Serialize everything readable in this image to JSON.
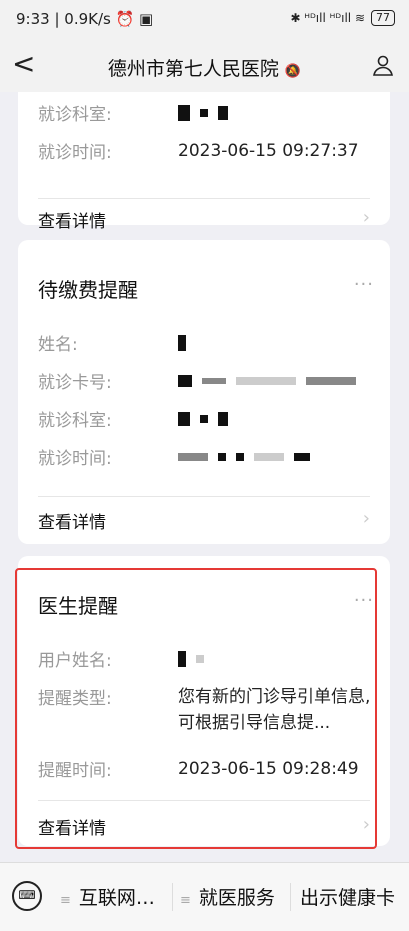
{
  "status_bar": {
    "time": "9:33",
    "speed": "0.9K/s",
    "signal": "✱ ᴴᴰıll ᴴᴰıll ≋",
    "battery": "77"
  },
  "nav": {
    "back": "<",
    "title": "德州市第七人民医院",
    "mute_icon": "🔕"
  },
  "card1": {
    "dept_label": "就诊科室:",
    "time_label": "就诊时间:",
    "time_value": "2023-06-15 09:27:37",
    "detail": "查看详情"
  },
  "card2": {
    "title": "待缴费提醒",
    "more": "···",
    "name_label": "姓名:",
    "card_label": "就诊卡号:",
    "dept_label": "就诊科室:",
    "time_label": "就诊时间:",
    "detail": "查看详情"
  },
  "card3": {
    "title": "医生提醒",
    "more": "···",
    "user_label": "用户姓名:",
    "type_label": "提醒类型:",
    "type_value": "您有新的门诊导引单信息,可根据引导信息提...",
    "time_label": "提醒时间:",
    "time_value": "2023-06-15 09:28:49",
    "detail": "查看详情"
  },
  "bottom_menu": {
    "item1": "互联网…",
    "item2": "就医服务",
    "item3": "出示健康卡"
  }
}
